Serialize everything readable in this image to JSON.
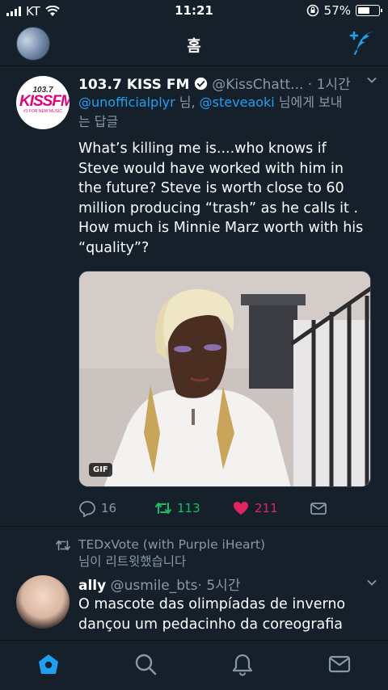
{
  "status_bar": {
    "carrier": "KT",
    "time": "11:21",
    "battery": "57%",
    "battery_level": 0.57
  },
  "nav": {
    "title": "홈"
  },
  "tweet1": {
    "name": "103.7 KISS FM",
    "handle": "@KissChatt...",
    "time": "· 1시간",
    "avatar": {
      "num": "103.7",
      "brand": "KISSFM",
      "tag": "#1 FOR NEW MUSIC"
    },
    "reply_to": {
      "user1": "@unofficialplyr",
      "mid": " 님, ",
      "user2": "@steveaoki",
      "suffix": " 님에게 보내는 답글"
    },
    "text": "What’s killing me is....who knows if Steve would have worked with him in the future? Steve is worth close to 60 million producing “trash” as he calls it . How much is Minnie Marz worth with his “quality”?",
    "media_badge": "GIF",
    "replies": "16",
    "retweets": "113",
    "likes": "211"
  },
  "retweet_context": {
    "line1": "TEDxVote (with Purple iHeart)",
    "line2": "님이 리트윗했습니다"
  },
  "tweet2": {
    "name": "ally",
    "handle": "@usmile_bts",
    "time": "· 5시간",
    "text": "O mascote das olimpíadas de inverno dançou um pedacinho da coreografia"
  },
  "colors": {
    "background": "#15202b",
    "accent": "#1da1f2",
    "retweet": "#17bf63",
    "like": "#e0245e",
    "muted": "#8899a6"
  }
}
